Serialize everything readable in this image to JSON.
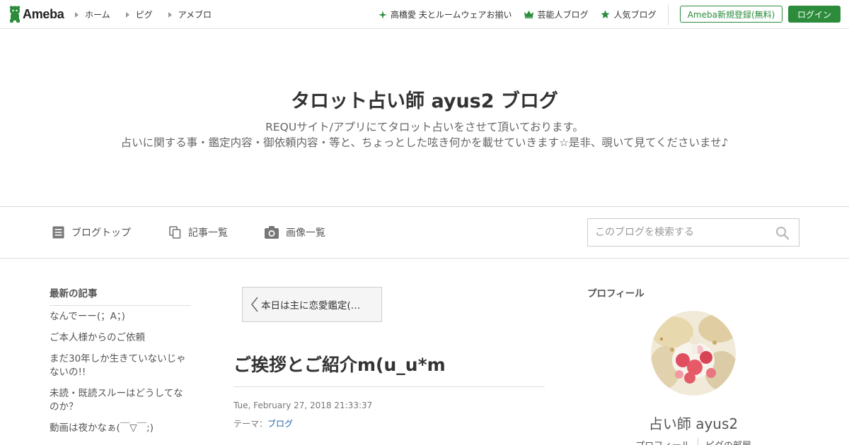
{
  "colors": {
    "accent_green": "#2d8c3c",
    "link_blue": "#2366a8"
  },
  "global_header": {
    "logo_text": "Ameba",
    "nav": [
      {
        "label": "ホーム"
      },
      {
        "label": "ピグ"
      },
      {
        "label": "アメブロ"
      }
    ],
    "links": [
      {
        "icon": "sparkle-icon",
        "label": "高橋愛 夫とルームウェアお揃い"
      },
      {
        "icon": "crown-icon",
        "label": "芸能人ブログ"
      },
      {
        "icon": "star-icon",
        "label": "人気ブログ"
      }
    ],
    "register_label": "Ameba新規登録(無料)",
    "login_label": "ログイン"
  },
  "blog": {
    "title": "タロット占い師 ayus2 ブログ",
    "description_line1": "REQUサイト/アプリにてタロット占いをさせて頂いております。",
    "description_line2": "占いに関する事・鑑定内容・御依頼内容・等と、ちょっとした呟き何かを載せていきます☆是非、覗いて見てくださいませ♪"
  },
  "blog_nav": {
    "items": [
      {
        "icon": "document-icon",
        "label": "ブログトップ"
      },
      {
        "icon": "copy-icon",
        "label": "記事一覧"
      },
      {
        "icon": "camera-icon",
        "label": "画像一覧"
      }
    ],
    "search_placeholder": "このブログを検索する"
  },
  "sidebar_left": {
    "title": "最新の記事",
    "items": [
      "なんでーー(；A；)",
      "ご本人様からのご依頼",
      "まだ30年しか生きていないじゃないの!!",
      "未読・既読スルーはどうしてなのか？",
      "動画は夜かなぁ(￣▽￣;)"
    ]
  },
  "entry": {
    "prev_label": "本日は主に恋愛鑑定(…",
    "title": "ご挨拶とご紹介m(u_u*m",
    "date": "Tue, February 27, 2018 21:33:37",
    "theme_label": "テーマ：",
    "theme_value": "ブログ"
  },
  "profile": {
    "title": "プロフィール",
    "name": "占い師 ayus2",
    "links": [
      "プロフィール",
      "ピグの部屋"
    ]
  }
}
